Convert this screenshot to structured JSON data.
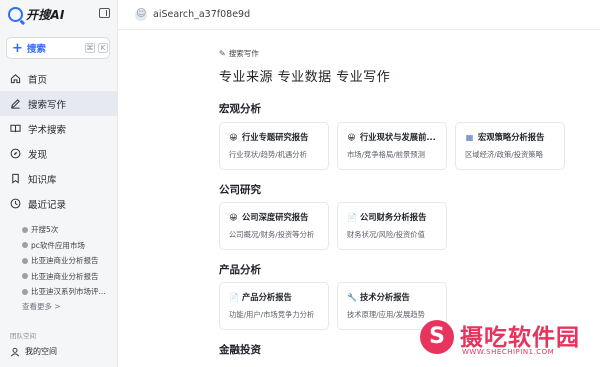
{
  "brand": {
    "name": "开搜AI"
  },
  "sidebar": {
    "search_button": {
      "label": "搜索",
      "kbd1": "⌘",
      "kbd2": "K"
    },
    "nav": [
      {
        "label": "首页",
        "icon": "home-icon"
      },
      {
        "label": "搜索写作",
        "icon": "pen-icon",
        "active": true
      },
      {
        "label": "学术搜索",
        "icon": "book-icon"
      },
      {
        "label": "发现",
        "icon": "compass-icon"
      },
      {
        "label": "知识库",
        "icon": "bookmark-icon"
      },
      {
        "label": "最近记录",
        "icon": "clock-icon"
      }
    ],
    "recent": [
      "开搜5次",
      "pc软件应用市场",
      "比亚迪商业分析报告",
      "比亚迪商业分析报告",
      "比亚迪汉系列市场评..."
    ],
    "see_more": "查看更多 >",
    "team_label": "团队空间",
    "my_space": "我的空间"
  },
  "topbar": {
    "session": "aiSearch_a37f08e9d"
  },
  "main": {
    "kicker": "搜索写作",
    "headline": "专业来源 专业数据 专业写作",
    "sections": [
      {
        "title": "宏观分析",
        "cards": [
          {
            "icon": "😀",
            "title": "行业专题研究报告",
            "desc": "行业现状/趋势/机遇分析"
          },
          {
            "icon": "😀",
            "title": "行业现状与发展前...",
            "desc": "市场/竞争格局/前景预测"
          },
          {
            "icon": "▦",
            "title": "宏观策略分析报告",
            "desc": "区域经济/政策/投资策略"
          }
        ]
      },
      {
        "title": "公司研究",
        "cards": [
          {
            "icon": "😀",
            "title": "公司深度研究报告",
            "desc": "公司概况/财务/投资等分析"
          },
          {
            "icon": "📄",
            "title": "公司财务分析报告",
            "desc": "财务状况/风险/投资价值"
          }
        ]
      },
      {
        "title": "产品分析",
        "cards": [
          {
            "icon": "📄",
            "title": "产品分析报告",
            "desc": "功能/用户/市场竞争力分析"
          },
          {
            "icon": "🔧",
            "title": "技术分析报告",
            "desc": "技术原理/应用/发展趋势"
          }
        ]
      },
      {
        "title": "金融投资",
        "cards": []
      }
    ]
  },
  "watermark": {
    "logo": "S",
    "text": "摄吃软件园",
    "url": "WWW.SHECHIPIN1.COM"
  }
}
